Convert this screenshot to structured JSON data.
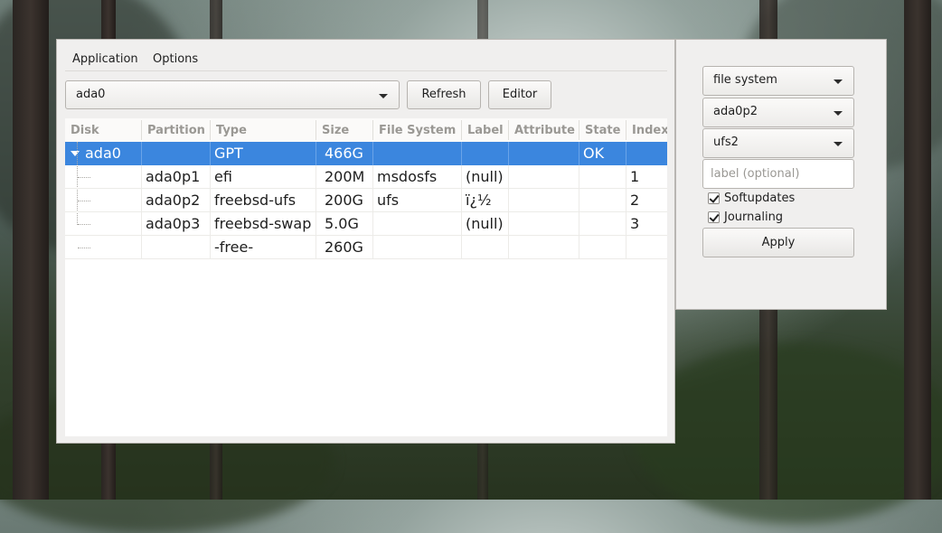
{
  "menubar": {
    "items": [
      "Application",
      "Options"
    ]
  },
  "toolbar": {
    "disk_select": "ada0",
    "refresh_label": "Refresh",
    "editor_label": "Editor"
  },
  "table": {
    "columns": [
      "Disk",
      "Partition",
      "Type",
      "Size",
      "File System",
      "Label",
      "Attribute",
      "State",
      "Index"
    ],
    "rows": [
      {
        "disk": "ada0",
        "partition": "",
        "type": "GPT",
        "size": "466G",
        "fs": "",
        "label": "",
        "attribute": "",
        "state": "OK",
        "index": "",
        "selected": true
      },
      {
        "disk": "",
        "partition": "ada0p1",
        "type": "efi",
        "size": "200M",
        "fs": "msdosfs",
        "label": "(null)",
        "attribute": "",
        "state": "",
        "index": "1"
      },
      {
        "disk": "",
        "partition": "ada0p2",
        "type": "freebsd-ufs",
        "size": "200G",
        "fs": "ufs",
        "label": "ï¿½",
        "attribute": "",
        "state": "",
        "index": "2"
      },
      {
        "disk": "",
        "partition": "ada0p3",
        "type": "freebsd-swap",
        "size": "5.0G",
        "fs": "",
        "label": "(null)",
        "attribute": "",
        "state": "",
        "index": "3"
      },
      {
        "disk": "",
        "partition": "",
        "type": "-free-",
        "size": "260G",
        "fs": "",
        "label": "",
        "attribute": "",
        "state": "",
        "index": ""
      }
    ]
  },
  "side_panel": {
    "action_select": "file system",
    "partition_select": "ada0p2",
    "fs_select": "ufs2",
    "label_placeholder": "label (optional)",
    "softupdates_label": "Softupdates",
    "softupdates_checked": true,
    "journaling_label": "Journaling",
    "journaling_checked": true,
    "apply_label": "Apply"
  },
  "colors": {
    "selection": "#3b86de",
    "window_bg": "#f0efee",
    "header_text": "#9a9894"
  },
  "icons": [
    "expander-down-icon",
    "checkmark-icon",
    "dropdown-arrow-icon"
  ]
}
